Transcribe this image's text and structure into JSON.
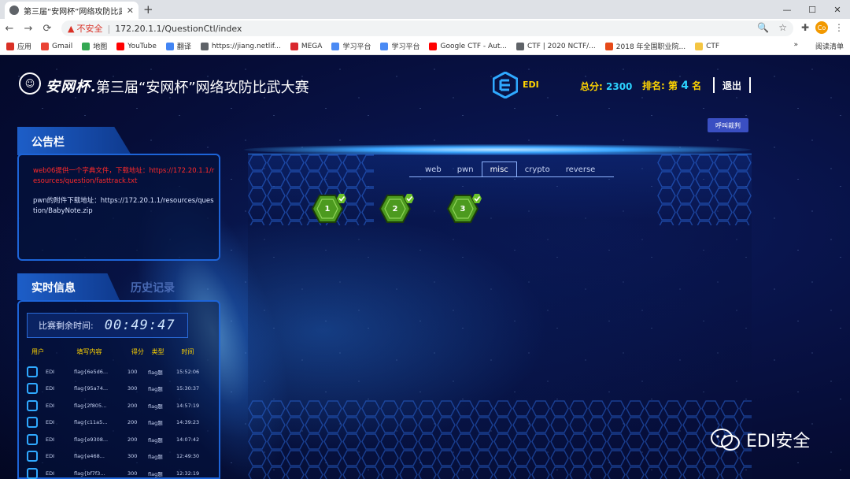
{
  "browser": {
    "tab_title": "第三届“安网杯”网络攻防比武大赛",
    "tab_close": "✕",
    "new_tab": "+",
    "window_buttons": [
      "—",
      "☐",
      "✕"
    ],
    "nav": {
      "back": "←",
      "forward": "→",
      "reload": "⟳"
    },
    "address": {
      "warning": "▲",
      "insecure_label": "不安全",
      "separator": "|",
      "url": "172.20.1.1/QuestionCtl/index"
    },
    "omni_icons": [
      "🔍",
      "☆"
    ],
    "avatar_label": "Co",
    "bookmarks": [
      {
        "label": "应用",
        "color": "#d93025"
      },
      {
        "label": "Gmail",
        "color": "#ea4335"
      },
      {
        "label": "地图",
        "color": "#34a853"
      },
      {
        "label": "YouTube",
        "color": "#ff0000"
      },
      {
        "label": "翻译",
        "color": "#4285f4"
      },
      {
        "label": "https://jiang.netlif...",
        "color": "#5f6368"
      },
      {
        "label": "MEGA",
        "color": "#d9272e"
      },
      {
        "label": "学习平台",
        "color": "#4a8af4"
      },
      {
        "label": "学习平台",
        "color": "#4a8af4"
      },
      {
        "label": "Google CTF - Aut...",
        "color": "#ff0000"
      },
      {
        "label": "CTF | 2020 NCTF/...",
        "color": "#5f6368"
      },
      {
        "label": "2018 年全国职业院...",
        "color": "#e64a19"
      },
      {
        "label": "CTF",
        "color": "#f4c542"
      }
    ],
    "bookmark_more": "»",
    "reading_list": "阅读清单"
  },
  "header": {
    "logo_char": "☺",
    "script_title": "安网杯.",
    "title": "第三届“安网杯”网络攻防比武大赛",
    "edi_label": "EDI",
    "score_label": "总分:",
    "score_value": "2300",
    "rank_label": "排名:",
    "rank_prefix": "第",
    "rank_value": "4",
    "rank_suffix": "名",
    "logout": "退出",
    "referee": "呼叫裁判"
  },
  "notice": {
    "title": "公告栏",
    "items": [
      "web06提供一个字典文件，下载地址：https://172.20.1.1/resources/question/fasttrack.txt",
      "pwn的附件下载地址：https://172.20.1.1/resources/question/BabyNote.zip"
    ]
  },
  "realtime": {
    "tab_active": "实时信息",
    "tab_history": "历史记录",
    "timer_label": "比赛剩余时间:",
    "timer_value": "00:49:47",
    "columns": [
      "用户",
      "填写内容",
      "得分",
      "类型",
      "时间"
    ],
    "rows": [
      {
        "user": "EDI",
        "content": "flag{6e5d6...",
        "score": "100",
        "type": "flag题",
        "time": "15:52:06"
      },
      {
        "user": "EDI",
        "content": "flag{95a74...",
        "score": "300",
        "type": "flag题",
        "time": "15:30:37"
      },
      {
        "user": "EDI",
        "content": "flag{2f805...",
        "score": "200",
        "type": "flag题",
        "time": "14:57:19"
      },
      {
        "user": "EDI",
        "content": "flag{c11a5...",
        "score": "200",
        "type": "flag题",
        "time": "14:39:23"
      },
      {
        "user": "EDI",
        "content": "flag{e9308...",
        "score": "200",
        "type": "flag题",
        "time": "14:07:42"
      },
      {
        "user": "EDI",
        "content": "flag{e468...",
        "score": "300",
        "type": "flag题",
        "time": "12:49:30"
      },
      {
        "user": "EDI",
        "content": "flag{bf7f3...",
        "score": "300",
        "type": "flag题",
        "time": "12:32:19"
      }
    ]
  },
  "categories": {
    "items": [
      "web",
      "pwn",
      "misc",
      "crypto",
      "reverse"
    ],
    "active": "misc"
  },
  "challenges": [
    {
      "label": "1",
      "solved": true
    },
    {
      "label": "2",
      "solved": true
    },
    {
      "label": "3",
      "solved": true
    }
  ],
  "watermark": "EDI安全",
  "colors": {
    "accent": "#ffd400",
    "value": "#2cd3ff",
    "hex_green": "#4c9a1f",
    "notice_red": "#ff2a2a"
  }
}
